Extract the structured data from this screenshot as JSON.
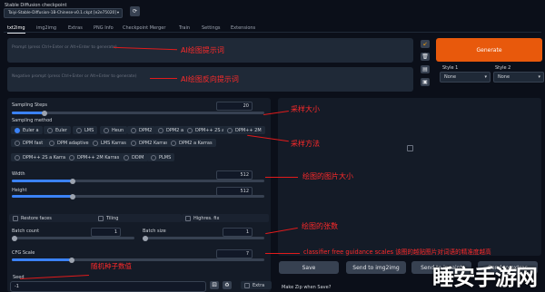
{
  "checkpoint": {
    "label": "Stable Diffusion checkpoint",
    "value": "Taiyi-Stable-Diffusion-1B-Chinese-v0.1.ckpt [e2e75020]"
  },
  "tabs": [
    "txt2img",
    "img2img",
    "Extras",
    "PNG Info",
    "Checkpoint Merger",
    "Train",
    "Settings",
    "Extensions"
  ],
  "prompt": {
    "placeholder": "Prompt (press Ctrl+Enter or Alt+Enter to generate)",
    "negative_placeholder": "Negative prompt (press Ctrl+Enter or Alt+Enter to generate)"
  },
  "generate_label": "Generate",
  "styles": {
    "style1_label": "Style 1",
    "style1_value": "None",
    "style2_label": "Style 2",
    "style2_value": "None"
  },
  "sampling": {
    "steps_label": "Sampling Steps",
    "steps_value": "20",
    "steps_fraction": 0.13,
    "method_label": "Sampling method",
    "methods": [
      "Euler a",
      "Euler",
      "LMS",
      "Heun",
      "DPM2",
      "DPM2 a",
      "DPM++ 2S a",
      "DPM++ 2M",
      "DPM fast",
      "DPM adaptive",
      "LMS Karras",
      "DPM2 Karras",
      "DPM2 a Karras",
      "DPM++ 2S a Karras",
      "DPM++ 2M Karras",
      "DDIM",
      "PLMS"
    ],
    "selected": "Euler a"
  },
  "size": {
    "width_label": "Width",
    "width_value": "512",
    "width_fraction": 0.24,
    "height_label": "Height",
    "height_value": "512",
    "height_fraction": 0.24
  },
  "options": {
    "restore_faces": "Restore faces",
    "tiling": "Tiling",
    "highres": "Highres. fix"
  },
  "batch": {
    "count_label": "Batch count",
    "count_value": "1",
    "size_label": "Batch size",
    "size_value": "1"
  },
  "cfg": {
    "label": "CFG Scale",
    "value": "7"
  },
  "seed": {
    "label": "Seed",
    "value": "-1",
    "extra_label": "Extra"
  },
  "output_buttons": [
    "Save",
    "Send to img2img",
    "Send to inpaint",
    "Send to extras"
  ],
  "zip_label": "Make Zip when Save?",
  "annotations": {
    "prompt": "AI绘图提示词",
    "negative": "AI绘图反向提示词",
    "steps": "采样大小",
    "method": "采样方法",
    "size": "绘图的图片大小",
    "batch": "绘图的张数",
    "cfg": "classifier free guidance scales 该图的越贴图片对词语的精准度越高",
    "seed": "随机种子数值"
  },
  "watermark": "睡安手游网",
  "colors": {
    "accent_orange": "#e8590c",
    "annotation_red": "#ff2a2a",
    "bg": "#0b0f19"
  }
}
